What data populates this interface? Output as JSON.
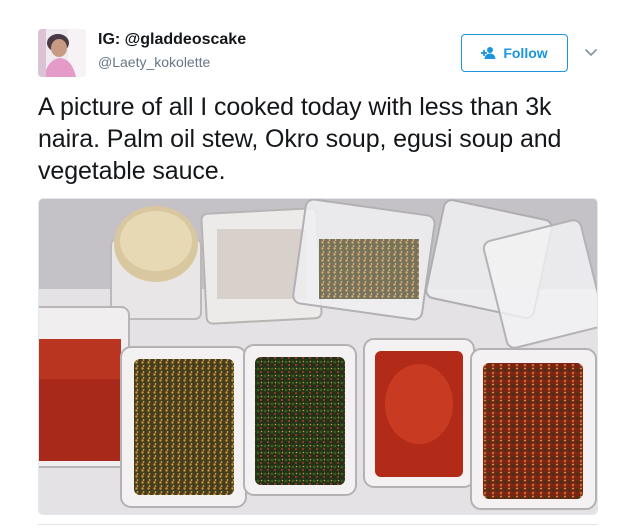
{
  "tweet": {
    "display_name": "IG: @gladdeoscake",
    "handle": "@Laety_kokolette",
    "follow_label": "Follow",
    "text": "A picture of all I cooked today with less than 3k naira. Palm oil stew, Okro soup, egusi soup and vegetable sauce."
  },
  "icons": {
    "follow": "add-user-icon",
    "caret": "chevron-down-icon"
  },
  "colors": {
    "accent": "#1b95e0",
    "handle": "#657786",
    "text": "#14171a"
  }
}
